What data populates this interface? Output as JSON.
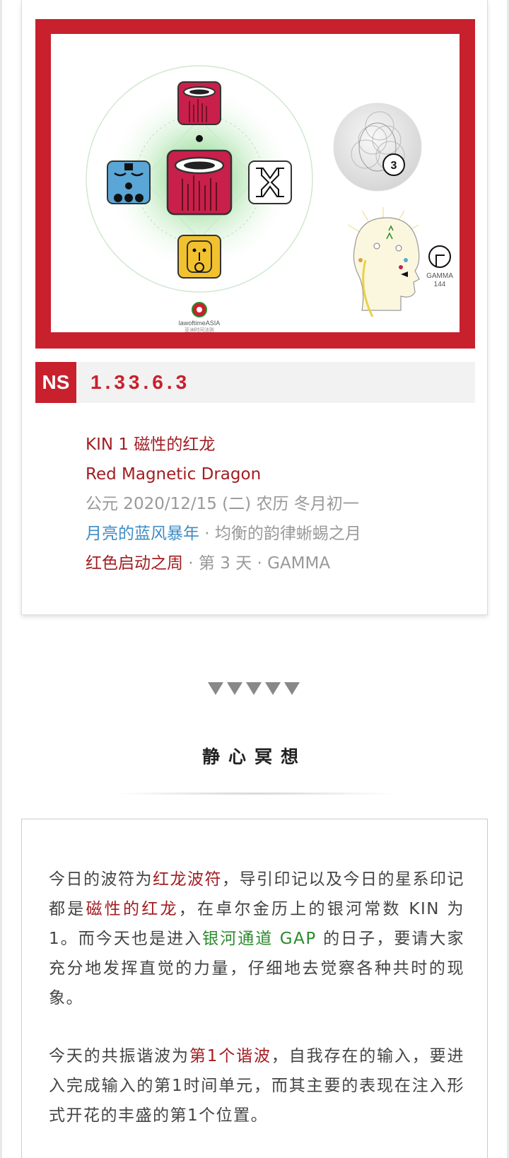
{
  "banner": {
    "logo_text": "lawoftimeASIA",
    "logo_sub": "亚洲时间法则",
    "tone_number": "3",
    "plasma_label": "GAMMA",
    "plasma_number": "144"
  },
  "code": {
    "badge": "NS",
    "value": "1.33.6.3"
  },
  "kin": {
    "line1": "KIN 1 磁性的红龙",
    "line2": "Red Magnetic Dragon",
    "line3": "公元 2020/12/15 (二)  农历 冬月初一",
    "line4_highlight": "月亮的蓝风暴年",
    "line4_rest": " · 均衡的韵律蜥蜴之月",
    "line5_highlight": "红色启动之周",
    "line5_rest": " · 第 3 天 · GAMMA"
  },
  "section": {
    "title": "静心冥想"
  },
  "paragraph1": {
    "t1": "今日的波符为",
    "h1": "红龙波符",
    "t2": "，导引印记以及今日的星系印记都是",
    "h2": "磁性的红龙",
    "t3": "，在卓尔金历上的银河常数 KIN 为1。而今天也是进入",
    "h3": "银河通道 GAP",
    "t4": " 的日子，要请大家充分地发挥直觉的力量，仔细地去觉察各种共时的现象。"
  },
  "paragraph2": {
    "t1": "今天的共振谐波为",
    "h1": "第1个谐波",
    "t2": "，自我存在的输入，要进入完成输入的第1时间单元，而其主要的表现在注入形式开花的丰盛的第1个位置。"
  },
  "colors": {
    "brand_red": "#c8202c",
    "text_red": "#a21d22",
    "text_blue": "#3f8cc4",
    "text_green": "#2b8a2b"
  }
}
